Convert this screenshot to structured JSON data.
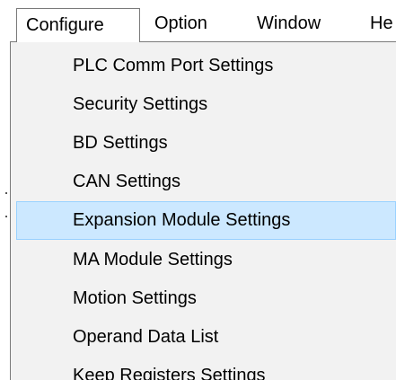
{
  "menubar": {
    "configure": "Configure",
    "option": "Option",
    "window": "Window",
    "help_partial": "He"
  },
  "configure_menu": {
    "items": [
      {
        "label": "PLC Comm Port Settings"
      },
      {
        "label": "Security Settings"
      },
      {
        "label": "BD Settings"
      },
      {
        "label": "CAN Settings"
      },
      {
        "label": "Expansion Module Settings",
        "highlighted": true
      },
      {
        "label": "MA Module Settings"
      },
      {
        "label": "Motion Settings"
      },
      {
        "label": "Operand Data List"
      },
      {
        "label": "Keep Registers Settings"
      }
    ]
  },
  "colors": {
    "highlight_fill": "#cce8ff",
    "highlight_border": "#99d1ff",
    "menu_background": "#f2f2f2"
  }
}
